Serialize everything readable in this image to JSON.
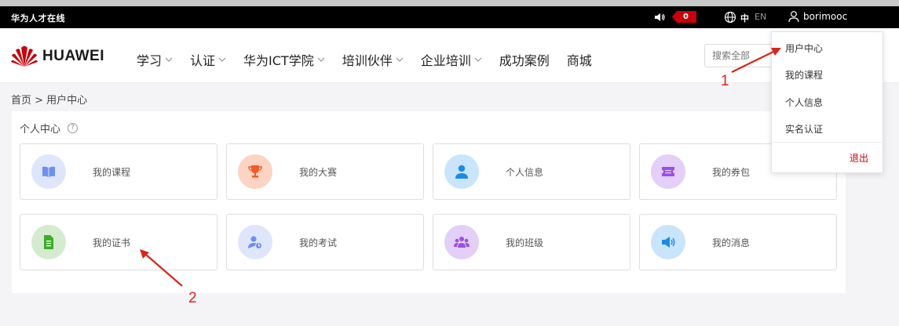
{
  "topbar": {
    "brand": "华为人才在线",
    "notification_count": "0",
    "lang_zh": "中",
    "lang_en": "EN",
    "username": "borimooc"
  },
  "header": {
    "logo_text": "HUAWEI",
    "nav": [
      {
        "label": "学习",
        "has_dropdown": true
      },
      {
        "label": "认证",
        "has_dropdown": true
      },
      {
        "label": "华为ICT学院",
        "has_dropdown": true
      },
      {
        "label": "培训伙伴",
        "has_dropdown": true
      },
      {
        "label": "企业培训",
        "has_dropdown": true
      },
      {
        "label": "成功案例",
        "has_dropdown": false
      },
      {
        "label": "商城",
        "has_dropdown": false
      }
    ],
    "search_placeholder": "搜索全部"
  },
  "breadcrumb": "首页 > 用户中心",
  "panel": {
    "title": "个人中心",
    "help": "?",
    "cards": [
      {
        "label": "我的课程",
        "icon": "book-icon",
        "color": "#dfe6fb",
        "icon_color": "#6f8ff0"
      },
      {
        "label": "我的大赛",
        "icon": "trophy-icon",
        "color": "#fdd3c4",
        "icon_color": "#f35a28"
      },
      {
        "label": "个人信息",
        "icon": "person-icon",
        "color": "#c9e5fb",
        "icon_color": "#1c8be6"
      },
      {
        "label": "我的券包",
        "icon": "ticket-icon",
        "color": "#e3cff7",
        "icon_color": "#9d4fe0"
      },
      {
        "label": "我的证书",
        "icon": "certificate-icon",
        "color": "#d5ebd0",
        "icon_color": "#3eab2c"
      },
      {
        "label": "我的考试",
        "icon": "exam-user-icon",
        "color": "#dfe6fb",
        "icon_color": "#6f8ff0"
      },
      {
        "label": "我的班级",
        "icon": "group-icon",
        "color": "#e3cff7",
        "icon_color": "#9d4fe0"
      },
      {
        "label": "我的消息",
        "icon": "speaker-icon",
        "color": "#c9e5fb",
        "icon_color": "#1c8be6"
      }
    ]
  },
  "dropdown": {
    "items": [
      "用户中心",
      "我的课程",
      "个人信息",
      "实名认证"
    ],
    "logout": "退出"
  },
  "annotations": {
    "label_1": "1",
    "label_2": "2",
    "color": "#d9261c"
  },
  "brand_color": "#c7000b"
}
